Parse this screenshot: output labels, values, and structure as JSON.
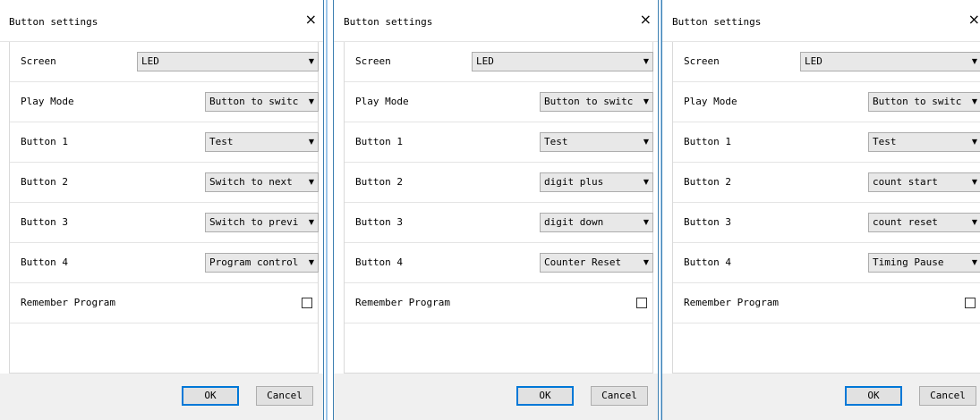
{
  "dialogs": [
    {
      "title": "Button settings",
      "close": "×",
      "rows": [
        {
          "label": "Screen",
          "value": "LED"
        },
        {
          "label": "Play Mode",
          "value": "Button to switc"
        },
        {
          "label": "Button 1",
          "value": "Test"
        },
        {
          "label": "Button 2",
          "value": "Switch to next"
        },
        {
          "label": "Button 3",
          "value": "Switch to previ"
        },
        {
          "label": "Button 4",
          "value": "Program control"
        }
      ],
      "remember_label": "Remember Program",
      "ok": "OK",
      "cancel": "Cancel"
    },
    {
      "title": "Button settings",
      "close": "×",
      "rows": [
        {
          "label": "Screen",
          "value": "LED"
        },
        {
          "label": "Play Mode",
          "value": "Button to switc"
        },
        {
          "label": "Button 1",
          "value": "Test"
        },
        {
          "label": "Button 2",
          "value": "digit plus"
        },
        {
          "label": "Button 3",
          "value": "digit down"
        },
        {
          "label": "Button 4",
          "value": "Counter Reset"
        }
      ],
      "remember_label": "Remember Program",
      "ok": "OK",
      "cancel": "Cancel"
    },
    {
      "title": "Button settings",
      "close": "×",
      "rows": [
        {
          "label": "Screen",
          "value": "LED"
        },
        {
          "label": "Play Mode",
          "value": "Button to switc"
        },
        {
          "label": "Button 1",
          "value": "Test"
        },
        {
          "label": "Button 2",
          "value": "count start"
        },
        {
          "label": "Button 3",
          "value": "count reset"
        },
        {
          "label": "Button 4",
          "value": "Timing Pause"
        }
      ],
      "remember_label": "Remember Program",
      "ok": "OK",
      "cancel": "Cancel"
    }
  ],
  "icons": {
    "dropdown": "chevron-down-icon",
    "close": "close-icon"
  },
  "colors": {
    "accent": "#0078d7",
    "frame": "#3c7fb1",
    "footer": "#f0f0f0"
  }
}
